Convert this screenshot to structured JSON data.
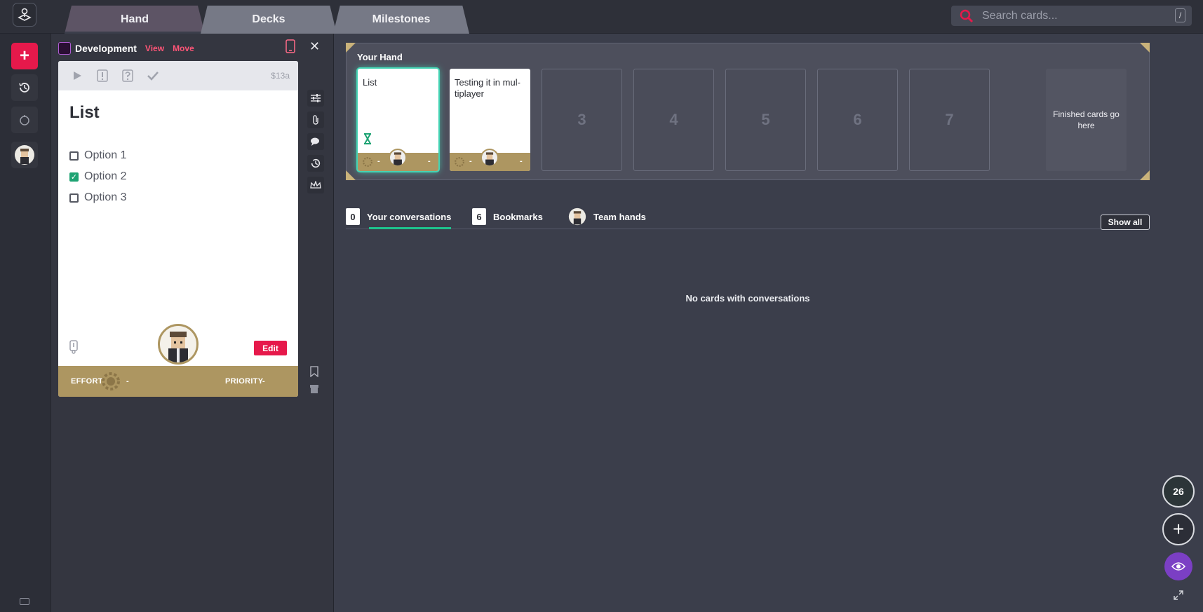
{
  "topbar": {
    "tabs": [
      {
        "label": "Hand"
      },
      {
        "label": "Decks"
      },
      {
        "label": "Milestones"
      }
    ],
    "search": {
      "placeholder": "Search cards...",
      "shortcut": "/"
    }
  },
  "left_rail": {
    "items": [
      "add-icon",
      "history-icon",
      "timer-icon",
      "avatar"
    ]
  },
  "panel": {
    "deck_name": "Development",
    "links": {
      "view": "View",
      "move": "Move"
    },
    "card": {
      "id": "$13a",
      "title": "List",
      "options": [
        {
          "label": "Option 1",
          "checked": false
        },
        {
          "label": "Option 2",
          "checked": true
        },
        {
          "label": "Option 3",
          "checked": false
        }
      ],
      "edit_label": "Edit",
      "effort_label": "EFFORT",
      "effort_value": "-",
      "priority_label": "PRIORITY",
      "priority_value": "-"
    }
  },
  "hand": {
    "title": "Your Hand",
    "cards": [
      {
        "title": "List",
        "effort": "-",
        "priority": "-",
        "active": true
      },
      {
        "title": "Testing it in mul-tiplayer",
        "effort": "-",
        "priority": "-",
        "active": false
      }
    ],
    "slots": [
      "3",
      "4",
      "5",
      "6",
      "7"
    ],
    "finished_text": "Finished cards go here"
  },
  "conversations": {
    "tabs": [
      {
        "badge": "0",
        "label": "Your conversations"
      },
      {
        "badge": "6",
        "label": "Bookmarks"
      },
      {
        "badge": "",
        "label": "Team hands"
      }
    ],
    "show_all": "Show all",
    "empty_message": "No cards with conversations"
  },
  "fabs": {
    "count": "26"
  },
  "colors": {
    "accent": "#e6194b",
    "gold": "#ad9661",
    "teal": "#1ec48d",
    "purple": "#7b3fc4"
  }
}
